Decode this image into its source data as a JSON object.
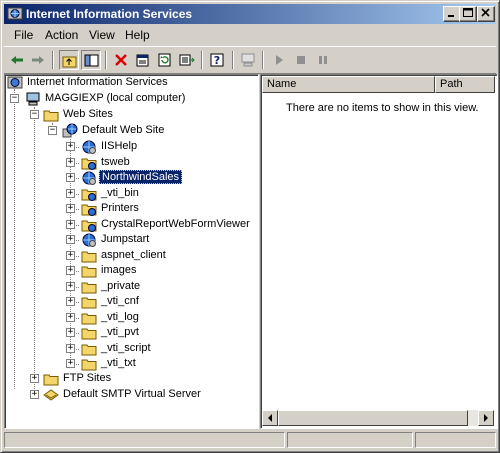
{
  "window": {
    "title": "Internet Information Services",
    "controls": {
      "minimize": "_",
      "maximize": "□",
      "close": "×"
    }
  },
  "menu": {
    "items": [
      "File",
      "Action",
      "View",
      "Help"
    ]
  },
  "toolbar": {
    "buttons": [
      "back-icon",
      "forward-icon",
      "up-folder-icon",
      "show-hide-tree-icon",
      "delete-icon",
      "properties-icon",
      "refresh-icon",
      "export-list-icon",
      "help-icon",
      "computer-icon",
      "play-icon",
      "stop-icon",
      "pause-icon"
    ]
  },
  "tree": {
    "root": "Internet Information Services",
    "computer": "MAGGIEXP (local computer)",
    "web_sites": "Web Sites",
    "default_site": "Default Web Site",
    "children": [
      {
        "label": "IISHelp",
        "icon": "globe-gear-icon"
      },
      {
        "label": "tsweb",
        "icon": "folder-globe-icon"
      },
      {
        "label": "NorthwindSales",
        "icon": "globe-gear-icon",
        "selected": true
      },
      {
        "label": "_vti_bin",
        "icon": "folder-globe-icon"
      },
      {
        "label": "Printers",
        "icon": "folder-globe-icon"
      },
      {
        "label": "CrystalReportWebFormViewer",
        "icon": "folder-globe-icon"
      },
      {
        "label": "Jumpstart",
        "icon": "globe-gear-icon"
      },
      {
        "label": "aspnet_client",
        "icon": "folder-icon"
      },
      {
        "label": "images",
        "icon": "folder-icon"
      },
      {
        "label": "_private",
        "icon": "folder-icon"
      },
      {
        "label": "_vti_cnf",
        "icon": "folder-icon"
      },
      {
        "label": "_vti_log",
        "icon": "folder-icon"
      },
      {
        "label": "_vti_pvt",
        "icon": "folder-icon"
      },
      {
        "label": "_vti_script",
        "icon": "folder-icon"
      },
      {
        "label": "_vti_txt",
        "icon": "folder-icon"
      }
    ],
    "ftp_sites": "FTP Sites",
    "smtp": "Default SMTP Virtual Server"
  },
  "list": {
    "columns": [
      "Name",
      "Path"
    ],
    "empty_message": "There are no items to show in this view."
  },
  "colors": {
    "title_start": "#0a246a",
    "title_end": "#a6caf0",
    "selection": "#0a246a",
    "face": "#d4d0c8"
  }
}
